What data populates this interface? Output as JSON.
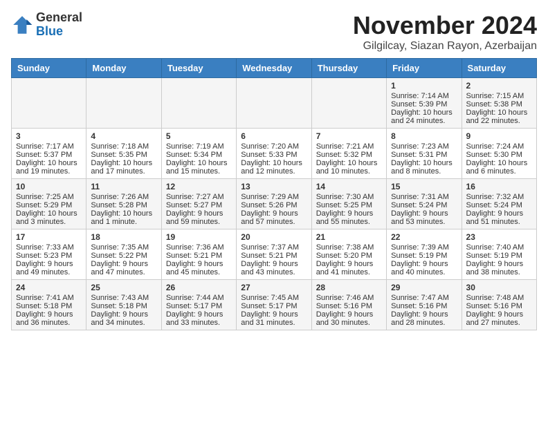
{
  "header": {
    "logo_line1": "General",
    "logo_line2": "Blue",
    "title": "November 2024",
    "subtitle": "Gilgilcay, Siazan Rayon, Azerbaijan"
  },
  "weekdays": [
    "Sunday",
    "Monday",
    "Tuesday",
    "Wednesday",
    "Thursday",
    "Friday",
    "Saturday"
  ],
  "weeks": [
    [
      {
        "day": "",
        "content": ""
      },
      {
        "day": "",
        "content": ""
      },
      {
        "day": "",
        "content": ""
      },
      {
        "day": "",
        "content": ""
      },
      {
        "day": "",
        "content": ""
      },
      {
        "day": "1",
        "content": "Sunrise: 7:14 AM\nSunset: 5:39 PM\nDaylight: 10 hours and 24 minutes."
      },
      {
        "day": "2",
        "content": "Sunrise: 7:15 AM\nSunset: 5:38 PM\nDaylight: 10 hours and 22 minutes."
      }
    ],
    [
      {
        "day": "3",
        "content": "Sunrise: 7:17 AM\nSunset: 5:37 PM\nDaylight: 10 hours and 19 minutes."
      },
      {
        "day": "4",
        "content": "Sunrise: 7:18 AM\nSunset: 5:35 PM\nDaylight: 10 hours and 17 minutes."
      },
      {
        "day": "5",
        "content": "Sunrise: 7:19 AM\nSunset: 5:34 PM\nDaylight: 10 hours and 15 minutes."
      },
      {
        "day": "6",
        "content": "Sunrise: 7:20 AM\nSunset: 5:33 PM\nDaylight: 10 hours and 12 minutes."
      },
      {
        "day": "7",
        "content": "Sunrise: 7:21 AM\nSunset: 5:32 PM\nDaylight: 10 hours and 10 minutes."
      },
      {
        "day": "8",
        "content": "Sunrise: 7:23 AM\nSunset: 5:31 PM\nDaylight: 10 hours and 8 minutes."
      },
      {
        "day": "9",
        "content": "Sunrise: 7:24 AM\nSunset: 5:30 PM\nDaylight: 10 hours and 6 minutes."
      }
    ],
    [
      {
        "day": "10",
        "content": "Sunrise: 7:25 AM\nSunset: 5:29 PM\nDaylight: 10 hours and 3 minutes."
      },
      {
        "day": "11",
        "content": "Sunrise: 7:26 AM\nSunset: 5:28 PM\nDaylight: 10 hours and 1 minute."
      },
      {
        "day": "12",
        "content": "Sunrise: 7:27 AM\nSunset: 5:27 PM\nDaylight: 9 hours and 59 minutes."
      },
      {
        "day": "13",
        "content": "Sunrise: 7:29 AM\nSunset: 5:26 PM\nDaylight: 9 hours and 57 minutes."
      },
      {
        "day": "14",
        "content": "Sunrise: 7:30 AM\nSunset: 5:25 PM\nDaylight: 9 hours and 55 minutes."
      },
      {
        "day": "15",
        "content": "Sunrise: 7:31 AM\nSunset: 5:24 PM\nDaylight: 9 hours and 53 minutes."
      },
      {
        "day": "16",
        "content": "Sunrise: 7:32 AM\nSunset: 5:24 PM\nDaylight: 9 hours and 51 minutes."
      }
    ],
    [
      {
        "day": "17",
        "content": "Sunrise: 7:33 AM\nSunset: 5:23 PM\nDaylight: 9 hours and 49 minutes."
      },
      {
        "day": "18",
        "content": "Sunrise: 7:35 AM\nSunset: 5:22 PM\nDaylight: 9 hours and 47 minutes."
      },
      {
        "day": "19",
        "content": "Sunrise: 7:36 AM\nSunset: 5:21 PM\nDaylight: 9 hours and 45 minutes."
      },
      {
        "day": "20",
        "content": "Sunrise: 7:37 AM\nSunset: 5:21 PM\nDaylight: 9 hours and 43 minutes."
      },
      {
        "day": "21",
        "content": "Sunrise: 7:38 AM\nSunset: 5:20 PM\nDaylight: 9 hours and 41 minutes."
      },
      {
        "day": "22",
        "content": "Sunrise: 7:39 AM\nSunset: 5:19 PM\nDaylight: 9 hours and 40 minutes."
      },
      {
        "day": "23",
        "content": "Sunrise: 7:40 AM\nSunset: 5:19 PM\nDaylight: 9 hours and 38 minutes."
      }
    ],
    [
      {
        "day": "24",
        "content": "Sunrise: 7:41 AM\nSunset: 5:18 PM\nDaylight: 9 hours and 36 minutes."
      },
      {
        "day": "25",
        "content": "Sunrise: 7:43 AM\nSunset: 5:18 PM\nDaylight: 9 hours and 34 minutes."
      },
      {
        "day": "26",
        "content": "Sunrise: 7:44 AM\nSunset: 5:17 PM\nDaylight: 9 hours and 33 minutes."
      },
      {
        "day": "27",
        "content": "Sunrise: 7:45 AM\nSunset: 5:17 PM\nDaylight: 9 hours and 31 minutes."
      },
      {
        "day": "28",
        "content": "Sunrise: 7:46 AM\nSunset: 5:16 PM\nDaylight: 9 hours and 30 minutes."
      },
      {
        "day": "29",
        "content": "Sunrise: 7:47 AM\nSunset: 5:16 PM\nDaylight: 9 hours and 28 minutes."
      },
      {
        "day": "30",
        "content": "Sunrise: 7:48 AM\nSunset: 5:16 PM\nDaylight: 9 hours and 27 minutes."
      }
    ]
  ]
}
